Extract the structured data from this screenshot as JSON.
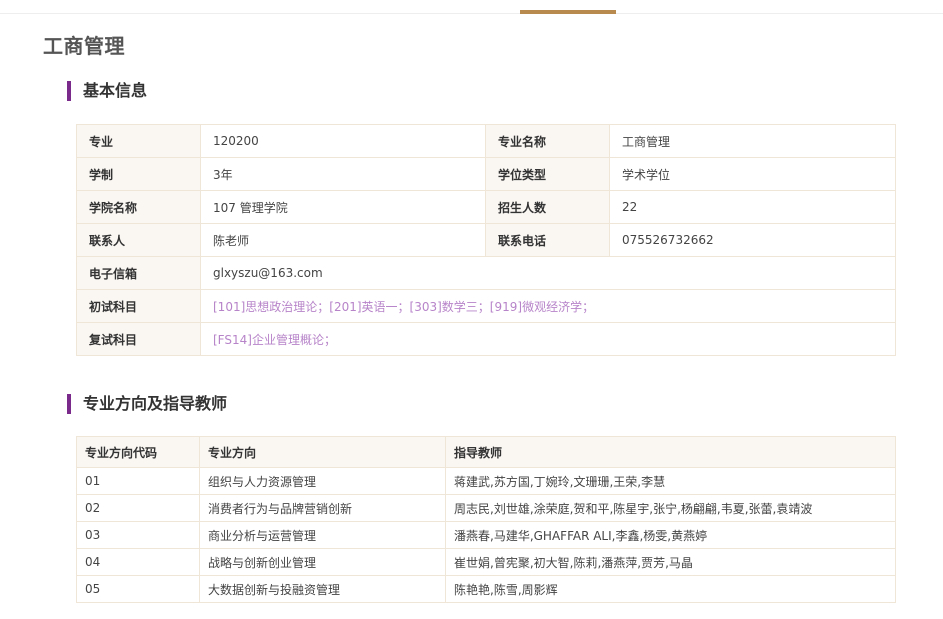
{
  "page": {
    "title": "工商管理"
  },
  "basic_info": {
    "section_title": "基本信息",
    "rows": [
      [
        {
          "label": "专业",
          "value": "120200"
        },
        {
          "label": "专业名称",
          "value": "工商管理"
        }
      ],
      [
        {
          "label": "学制",
          "value": "3年"
        },
        {
          "label": "学位类型",
          "value": "学术学位"
        }
      ],
      [
        {
          "label": "学院名称",
          "value": "107 管理学院"
        },
        {
          "label": "招生人数",
          "value": "22"
        }
      ],
      [
        {
          "label": "联系人",
          "value": "陈老师"
        },
        {
          "label": "联系电话",
          "value": "075526732662"
        }
      ]
    ],
    "email": {
      "label": "电子信箱",
      "value": "glxyszu@163.com"
    },
    "initial_exam": {
      "label": "初试科目",
      "value": "[101]思想政治理论；[201]英语一；[303]数学三；[919]微观经济学；"
    },
    "retest": {
      "label": "复试科目",
      "value": "[FS14]企业管理概论；"
    }
  },
  "directions": {
    "section_title": "专业方向及指导教师",
    "headers": [
      "专业方向代码",
      "专业方向",
      "指导教师"
    ],
    "rows": [
      [
        "01",
        "组织与人力资源管理",
        "蒋建武,苏方国,丁婉玲,文珊珊,王荣,李慧"
      ],
      [
        "02",
        "消费者行为与品牌营销创新",
        "周志民,刘世雄,涂荣庭,贺和平,陈星宇,张宁,杨翩翩,韦夏,张蕾,袁靖波"
      ],
      [
        "03",
        "商业分析与运营管理",
        "潘燕春,马建华,GHAFFAR ALI,李鑫,杨雯,黄燕婷"
      ],
      [
        "04",
        "战略与创新创业管理",
        "崔世娟,曾宪聚,初大智,陈莉,潘燕萍,贾芳,马晶"
      ],
      [
        "05",
        "大数据创新与投融资管理",
        "陈艳艳,陈雪,周影辉"
      ]
    ]
  },
  "colors": {
    "accent": "#7a2a8a",
    "top_accent": "#b88a4e",
    "link": "#b784c9",
    "border": "#f0e6d8",
    "label_bg": "#faf7f3"
  }
}
